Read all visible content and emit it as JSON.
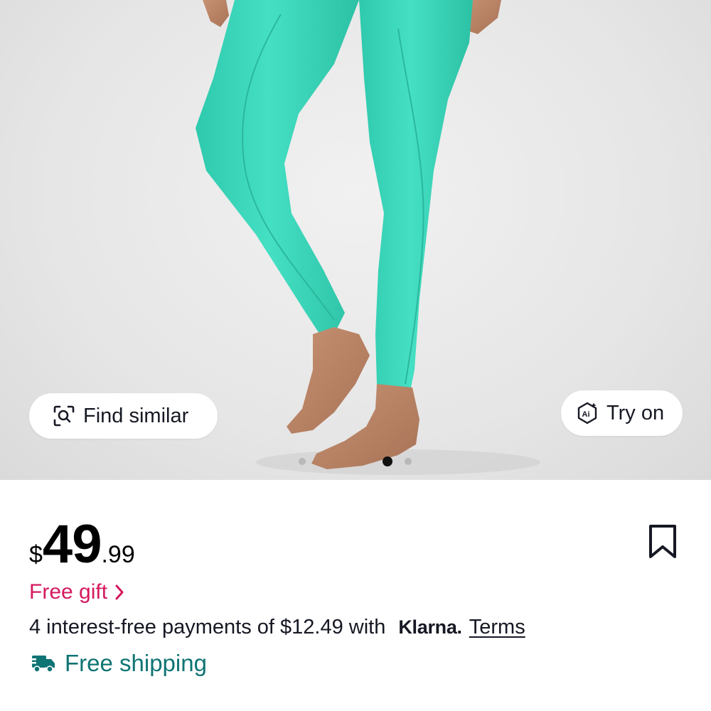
{
  "gallery": {
    "find_similar_label": "Find similar",
    "find_similar_icon": "search-scan-icon",
    "try_on_label": "Try on",
    "try_on_icon": "ai-sparkle-icon",
    "image_count": 4,
    "active_image_index": 2
  },
  "product": {
    "price_currency": "$",
    "price_whole": "49",
    "price_cents": ".99",
    "bookmark_icon": "bookmark-icon",
    "free_gift_label": "Free gift",
    "installments_text": "4 interest-free payments of $12.49 with",
    "klarna_label": "Klarna.",
    "terms_label": "Terms",
    "shipping_label": "Free shipping",
    "shipping_icon": "truck-icon"
  },
  "colors": {
    "legging": "#3dd8bc",
    "gift": "#d5195f",
    "shipping": "#0f7474",
    "text": "#161823"
  }
}
